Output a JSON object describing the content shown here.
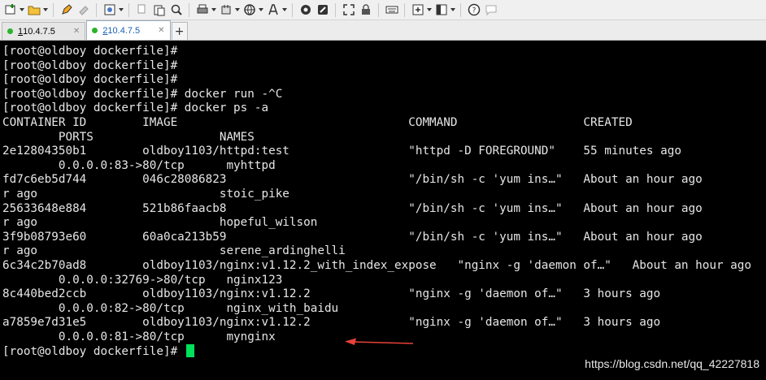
{
  "toolbar": {
    "icons": [
      "new-session-icon",
      "open-folder-icon",
      "pencil-icon",
      "eraser-icon",
      "properties-icon",
      "copy-icon",
      "paste-icon",
      "find-icon",
      "print-icon",
      "transfer-icon",
      "globe-icon",
      "font-icon",
      "script-icon",
      "compose-icon",
      "fullscreen-icon",
      "lock-icon",
      "keyboard-icon",
      "add-icon",
      "layout-icon",
      "help-icon",
      "chat-icon"
    ]
  },
  "tabs": [
    {
      "number": "1",
      "label": " 10.4.7.5"
    },
    {
      "number": "2",
      "label": " 10.4.7.5"
    }
  ],
  "tab_add_label": "+",
  "terminal": {
    "lines": [
      "[root@oldboy dockerfile]#",
      "[root@oldboy dockerfile]#",
      "[root@oldboy dockerfile]#",
      "[root@oldboy dockerfile]# docker run -^C",
      "[root@oldboy dockerfile]# docker ps -a",
      "CONTAINER ID        IMAGE                                 COMMAND                  CREATED",
      "        PORTS                  NAMES",
      "2e12804350b1        oldboy1103/httpd:test                 \"httpd -D FOREGROUND\"    55 minutes ago",
      "        0.0.0.0:83->80/tcp      myhttpd",
      "fd7c6eb5d744        046c28086823                          \"/bin/sh -c 'yum ins…\"   About an hour ago",
      "r ago                          stoic_pike",
      "25633648e884        521b86faacb8                          \"/bin/sh -c 'yum ins…\"   About an hour ago",
      "r ago                          hopeful_wilson",
      "3f9b08793e60        60a0ca213b59                          \"/bin/sh -c 'yum ins…\"   About an hour ago",
      "r ago                          serene_ardinghelli",
      "6c34c2b70ad8        oldboy1103/nginx:v1.12.2_with_index_expose   \"nginx -g 'daemon of…\"   About an hour ago",
      "        0.0.0.0:32769->80/tcp   nginx123",
      "8c440bed2ccb        oldboy1103/nginx:v1.12.2              \"nginx -g 'daemon of…\"   3 hours ago",
      "        0.0.0.0:82->80/tcp      nginx_with_baidu",
      "a7859e7d31e5        oldboy1103/nginx:v1.12.2              \"nginx -g 'daemon of…\"   3 hours ago",
      "        0.0.0.0:81->80/tcp      mynginx"
    ],
    "prompt": "[root@oldboy dockerfile]#"
  },
  "watermark": "https://blog.csdn.net/qq_42227818",
  "colors": {
    "cursor": "#00e05a",
    "arrow": "#e8413a",
    "tab_active_text": "#1a5fb4"
  }
}
